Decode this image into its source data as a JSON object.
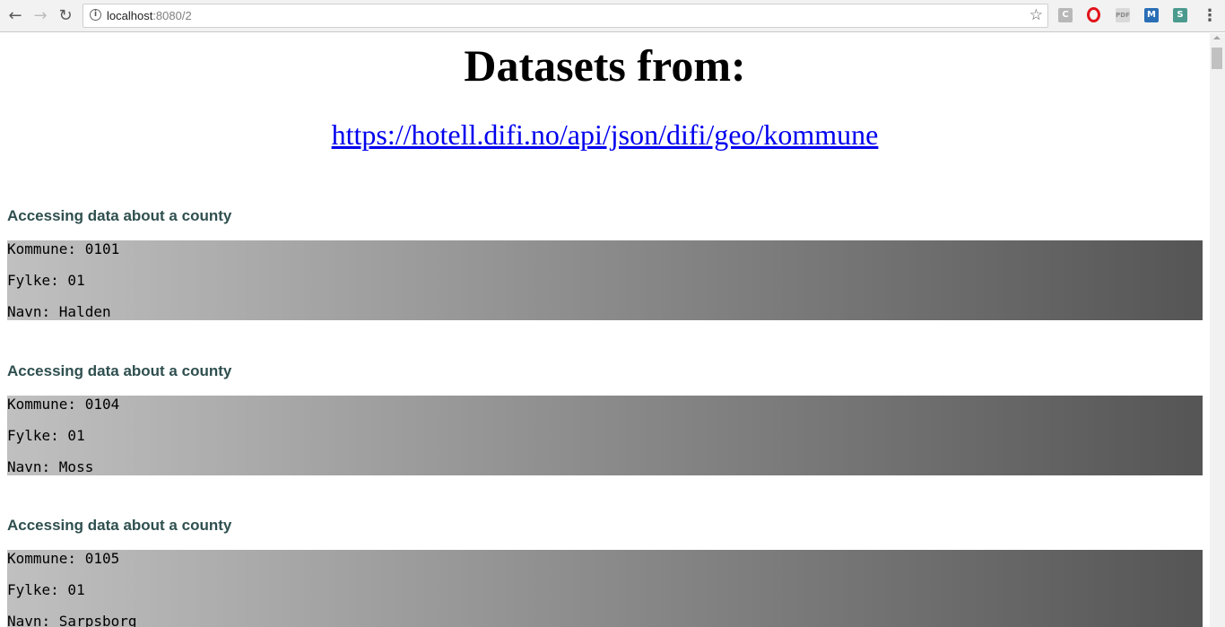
{
  "browser": {
    "url_host": "localhost",
    "url_rest": ":8080/2",
    "extensions": [
      "C",
      "O",
      "PDF",
      "M",
      "S"
    ]
  },
  "page": {
    "title": "Datasets from:",
    "source_link": "https://hotell.difi.no/api/json/difi/geo/kommune"
  },
  "records": [
    {
      "heading": "Accessing data about a county",
      "kommune": "Kommune: 0101",
      "fylke": "Fylke: 01",
      "navn": "Navn: Halden"
    },
    {
      "heading": "Accessing data about a county",
      "kommune": "Kommune: 0104",
      "fylke": "Fylke: 01",
      "navn": "Navn: Moss"
    },
    {
      "heading": "Accessing data about a county",
      "kommune": "Kommune: 0105",
      "fylke": "Fylke: 01",
      "navn": "Navn: Sarpsborg"
    }
  ],
  "icons": {
    "back": "back-arrow-icon",
    "forward": "forward-arrow-icon",
    "reload": "reload-icon",
    "info": "info-icon",
    "bookmark": "star-icon",
    "menu": "kebab-menu-icon"
  }
}
